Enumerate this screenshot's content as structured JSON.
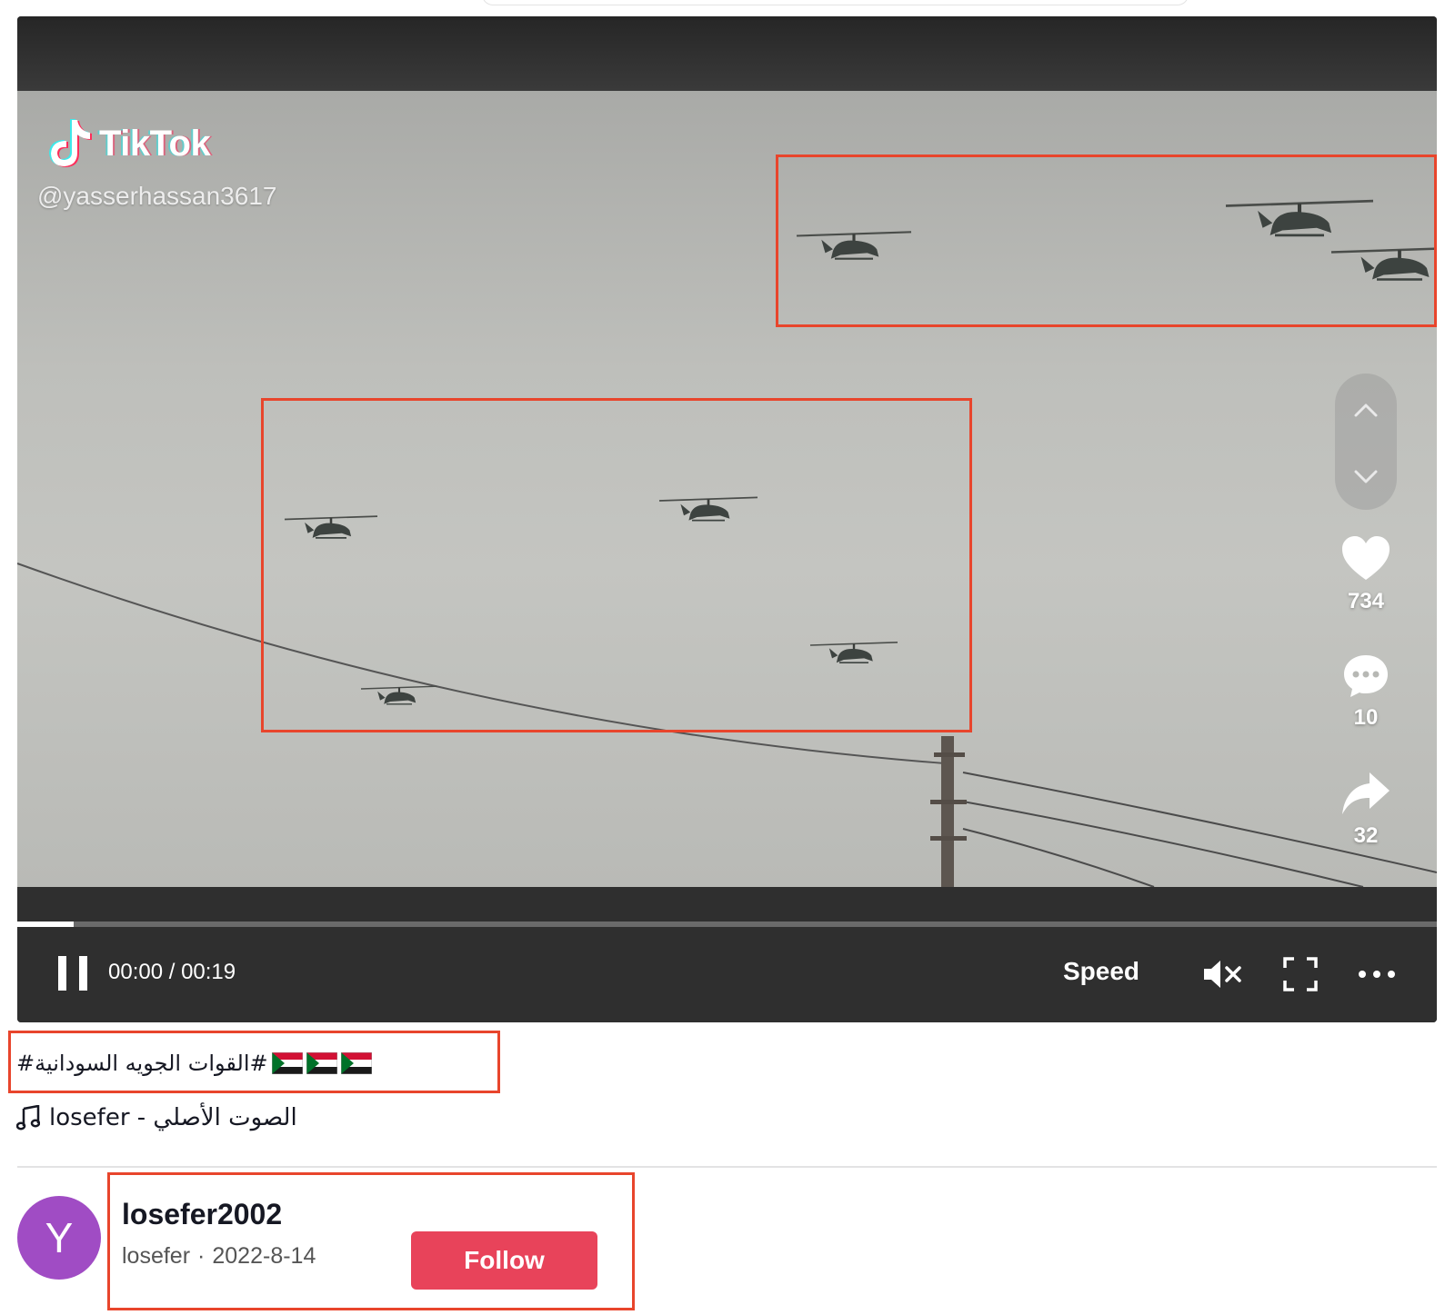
{
  "watermark": {
    "logo_text": "TikTok",
    "handle": "@yasserhassan3617"
  },
  "rail": {
    "likes": "734",
    "comments": "10",
    "shares": "32",
    "icons": [
      "chevron-up-icon",
      "chevron-down-icon",
      "heart-icon",
      "comment-icon",
      "share-icon"
    ]
  },
  "player": {
    "time": "00:00 / 00:19",
    "speed_label": "Speed",
    "progress": 0.04,
    "icons": [
      "pause-icon",
      "mute-icon",
      "fullscreen-icon",
      "more-icon"
    ]
  },
  "caption": {
    "text": "#القوات الجويه السودانية#",
    "flag_count": 3
  },
  "music": {
    "text": "الصوت الأصلي - losefer"
  },
  "author": {
    "avatar_letter": "Y",
    "username": "losefer2002",
    "nickname": "losefer",
    "separator": "·",
    "date": "2022-8-14",
    "follow_label": "Follow"
  },
  "colors": {
    "annotation": "#e8452c",
    "follow": "#e8435a",
    "avatar": "#a04cc4"
  }
}
